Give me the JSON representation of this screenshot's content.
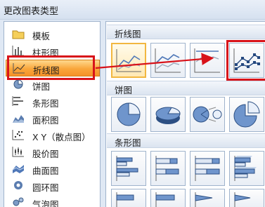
{
  "window": {
    "title": "更改图表类型"
  },
  "categories": [
    {
      "label": "模板",
      "icon": "folder-icon",
      "selected": false
    },
    {
      "label": "柱形图",
      "icon": "column-chart-icon",
      "selected": false
    },
    {
      "label": "折线图",
      "icon": "line-chart-icon",
      "selected": true
    },
    {
      "label": "饼图",
      "icon": "pie-chart-icon",
      "selected": false
    },
    {
      "label": "条形图",
      "icon": "bar-chart-icon",
      "selected": false
    },
    {
      "label": "面积图",
      "icon": "area-chart-icon",
      "selected": false
    },
    {
      "label": "X Y（散点图）",
      "icon": "scatter-chart-icon",
      "selected": false
    },
    {
      "label": "股价图",
      "icon": "stock-chart-icon",
      "selected": false
    },
    {
      "label": "曲面图",
      "icon": "surface-chart-icon",
      "selected": false
    },
    {
      "label": "圆环图",
      "icon": "doughnut-chart-icon",
      "selected": false
    },
    {
      "label": "气泡图",
      "icon": "bubble-chart-icon",
      "selected": false
    }
  ],
  "gallery": {
    "sections": [
      {
        "label": "折线图",
        "tiles": [
          "line-icon",
          "stacked-line-icon",
          "percent-stacked-line-icon",
          "line-with-markers-icon"
        ]
      },
      {
        "label": "饼图",
        "tiles": [
          "pie-icon",
          "pie-3d-icon",
          "pie-of-pie-icon",
          "exploded-pie-icon"
        ]
      },
      {
        "label": "条形图",
        "tiles": [
          "clustered-bar-icon",
          "stacked-bar-icon",
          "percent-stacked-bar-icon",
          "clustered-bar-3d-icon"
        ]
      }
    ],
    "selected_tile": "line-icon",
    "highlighted_tile": "line-with-markers-icon"
  },
  "annotations": {
    "color": "#d8131a"
  },
  "colors": {
    "selection_orange": "#f9a63b",
    "tile_selected_border": "#f2b740",
    "chart_blue": "#4f78b8"
  }
}
